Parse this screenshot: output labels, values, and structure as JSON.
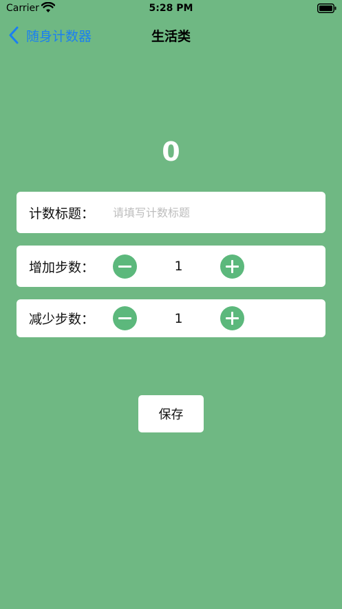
{
  "status_bar": {
    "carrier": "Carrier",
    "time": "5:28 PM"
  },
  "nav": {
    "back_label": "随身计数器",
    "title": "生活类",
    "accent": "#1a7ff2"
  },
  "counter": {
    "value": "0"
  },
  "form": {
    "title_label": "计数标题：",
    "title_value": "",
    "title_placeholder": "请填写计数标题",
    "increase_label": "增加步数：",
    "increase_value": "1",
    "decrease_label": "减少步数：",
    "decrease_value": "1"
  },
  "save_label": "保存",
  "colors": {
    "background": "#6fb883",
    "stepper": "#5cb87c"
  },
  "icons": [
    "wifi-icon",
    "battery-icon",
    "back-chevron-icon",
    "minus-icon",
    "plus-icon"
  ]
}
